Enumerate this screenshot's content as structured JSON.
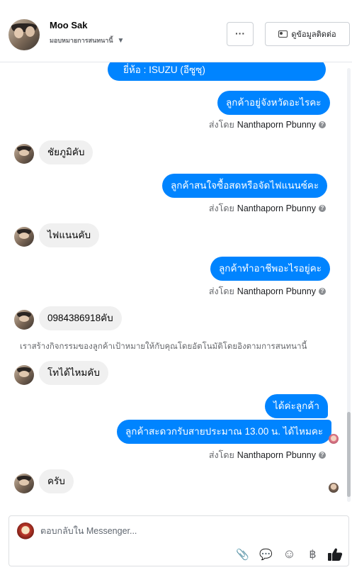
{
  "header": {
    "contact_name": "Moo Sak",
    "status_label": "มอบหมายการสนทนานี้",
    "more_label": "···",
    "info_button_label": "ดูข้อมูลติดต่อ"
  },
  "messages": [
    {
      "dir": "out",
      "text": "ยี่ห้อ : ISUZU (อีซูซุ)"
    },
    {
      "dir": "out",
      "text": "ลูกค้าอยู่จังหวัดอะไรคะ"
    },
    {
      "dir": "in",
      "text": "ชัยภูมิคับ"
    },
    {
      "dir": "out",
      "text": "ลูกค้าสนใจซื้อสดหรือจัดไฟแนนซ์คะ"
    },
    {
      "dir": "in",
      "text": "ไฟแนนคับ"
    },
    {
      "dir": "out",
      "text": "ลูกค้าทำอาชีพอะไรอยู่คะ"
    },
    {
      "dir": "in",
      "text": "0984386918คับ"
    },
    {
      "dir": "in",
      "text": "โทได้ไหมคับ"
    },
    {
      "dir": "out",
      "text": "ได้ค่ะลูกค้า"
    },
    {
      "dir": "out",
      "text": "ลูกค้าสะดวกรับสายประมาณ 13.00 น. ได้ไหมคะ"
    },
    {
      "dir": "in",
      "text": "ครับ"
    }
  ],
  "sent_by": {
    "prefix": "ส่งโดย",
    "agent_name": "Nanthaporn Pbunny",
    "info_glyph": "?"
  },
  "system_message": "เราสร้างกิจกรรมของลูกค้าเป้าหมายให้กับคุณโดยอัตโนมัติโดยอิงตามการสนทนานี้",
  "composer": {
    "placeholder": "ตอบกลับใน Messenger...",
    "tools": [
      {
        "name": "attachment-icon",
        "glyph": "📎"
      },
      {
        "name": "saved-reply-icon",
        "glyph": "💬"
      },
      {
        "name": "emoji-icon",
        "glyph": "☺"
      },
      {
        "name": "baht-icon",
        "glyph": "฿"
      }
    ]
  },
  "colors": {
    "outgoing_bubble": "#0084ff",
    "incoming_bubble": "#f0f0f0",
    "like_icon": "#1c1e21"
  }
}
